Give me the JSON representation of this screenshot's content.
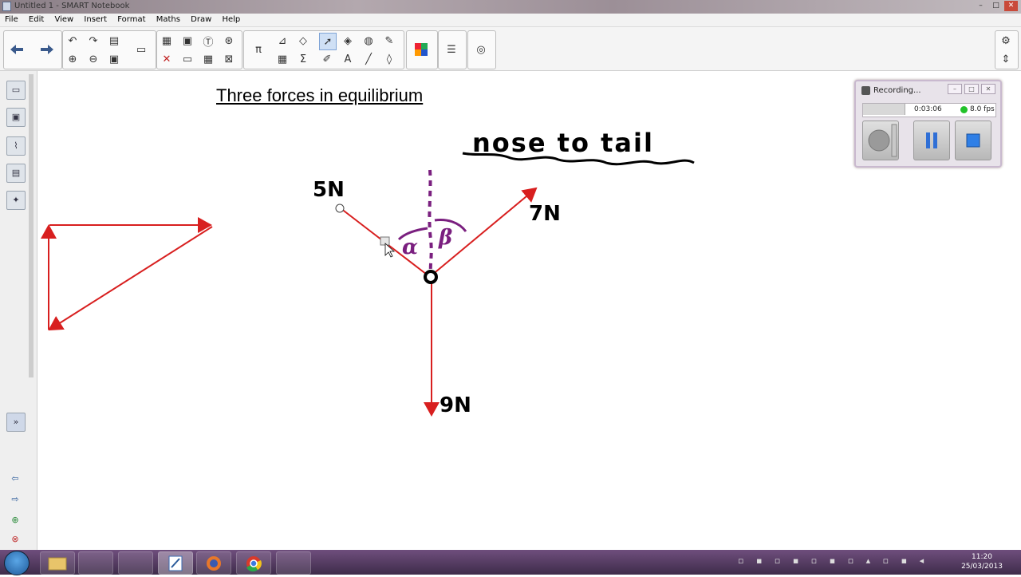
{
  "window": {
    "title": "Untitled 1 - SMART Notebook"
  },
  "menu": [
    "File",
    "Edit",
    "View",
    "Insert",
    "Format",
    "Maths",
    "Draw",
    "Help"
  ],
  "page": {
    "heading": "Three forces in equilibrium",
    "handwritten_note": "nose to tail",
    "force_labels": [
      "5N",
      "7N",
      "9N"
    ],
    "angle_labels": [
      "α",
      "β"
    ],
    "colors": {
      "force_arrows": "#d81f1f",
      "angle_annotations": "#7a1f7f",
      "ink": "#000000"
    }
  },
  "recorder": {
    "title": "Recording...",
    "time": "0:03:06",
    "fps": "8.0 fps",
    "status_color": "#22c22a"
  },
  "taskbar": {
    "time": "11:20",
    "date": "25/03/2013"
  }
}
